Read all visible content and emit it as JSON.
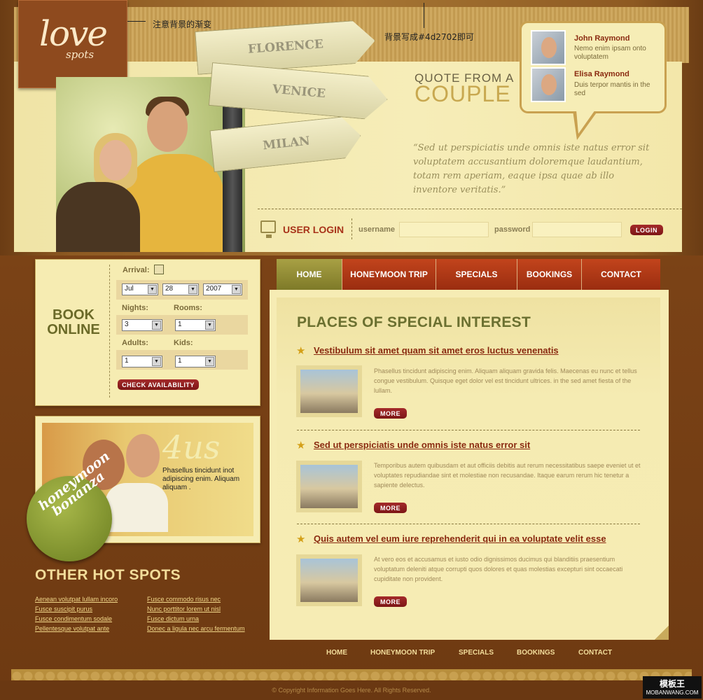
{
  "logo": {
    "line1": "love",
    "line2": "spots"
  },
  "notes": {
    "gradient": "注意背景的渐变",
    "bgcolor": "背景写成#4d2702即可"
  },
  "signs": [
    "FLORENCE",
    "VENICE",
    "MILAN"
  ],
  "quote": {
    "title1": "QUOTE FROM A",
    "title2": "COUPLE",
    "text": "“Sed ut perspiciatis unde omnis iste natus error sit voluptatem accusantium doloremque laudantium, totam rem aperiam, eaque ipsa quae ab illo inventore veritatis.”"
  },
  "testimonials": [
    {
      "name": "John Raymond",
      "text": "Nemo enim ipsam onto voluptatem"
    },
    {
      "name": "Elisa Raymond",
      "text": "Duis terpor mantis in the sed"
    }
  ],
  "login": {
    "title": "USER LOGIN",
    "username_label": "username",
    "password_label": "password",
    "button": "LOGIN",
    "username_value": "",
    "password_value": ""
  },
  "booking": {
    "title_line1": "BOOK",
    "title_line2": "ONLINE",
    "arrival_label": "Arrival:",
    "month": "Jul",
    "day": "28",
    "year": "2007",
    "nights_label": "Nights:",
    "rooms_label": "Rooms:",
    "nights": "3",
    "rooms": "1",
    "adults_label": "Adults:",
    "kids_label": "Kids:",
    "adults": "1",
    "kids": "1",
    "button": "CHECK AVAILABILITY"
  },
  "promo": {
    "heading": "4us",
    "text": "Phasellus tincidunt inot adipiscing enim. Aliquam aliquam .",
    "sticker1": "honeymoon",
    "sticker2": "bonanza"
  },
  "hot_spots": {
    "title": "OTHER HOT SPOTS",
    "left": [
      "Aenean volutpat lullam incoro",
      "Fusce suscipit purus",
      "Fusce condimentum sodale",
      "Pellentesque volutpat ante"
    ],
    "right": [
      "Fusce commodo risus nec",
      "Nunc porttitor lorem ut nisl",
      "Fusce dictum urna",
      "Donec a ligula nec arcu fermentum"
    ]
  },
  "nav": [
    "HOME",
    "HONEYMOON TRIP",
    "SPECIALS",
    "BOOKINGS",
    "CONTACT"
  ],
  "main": {
    "title": "PLACES OF SPECIAL INTEREST",
    "items": [
      {
        "title": "Vestibulum sit amet quam sit amet eros luctus venenatis",
        "text": "Phasellus tincidunt adipiscing enim. Aliquam aliquam gravida felis. Maecenas eu nunc et tellus congue vestibulum. Quisque eget dolor vel est tincidunt ultrices. in the sed amet fiesta of the lullam.",
        "button": "MORE"
      },
      {
        "title": "Sed ut perspiciatis unde omnis iste natus error sit",
        "text": "Temporibus autem quibusdam et aut officiis debitis aut rerum necessitatibus saepe eveniet ut et voluptates repudiandae sint et molestiae non recusandae. Itaque earum rerum hic tenetur a sapiente delectus.",
        "button": "MORE"
      },
      {
        "title": "Quis autem vel eum iure reprehenderit qui in ea voluptate velit esse",
        "text": "At vero eos et accusamus et iusto odio dignissimos ducimus qui blanditiis praesentium voluptatum deleniti atque corrupti quos dolores et quas molestias excepturi sint occaecati cupiditate non provident.",
        "button": "MORE"
      }
    ]
  },
  "footer": {
    "nav": [
      "HOME",
      "HONEYMOON TRIP",
      "SPECIALS",
      "BOOKINGS",
      "CONTACT"
    ],
    "copyright": "© Copyright Information Goes Here. All Rights Reserved."
  },
  "watermark": {
    "line1": "模板王",
    "line2": "MOBANWANG.COM"
  }
}
